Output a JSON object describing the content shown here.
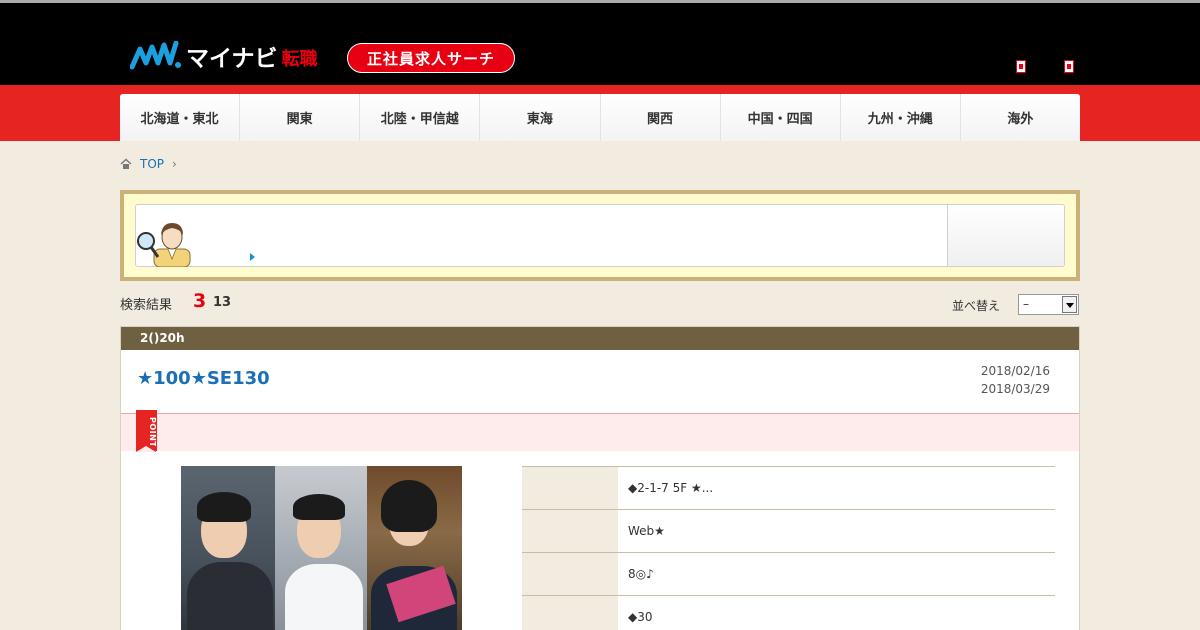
{
  "header": {
    "logo_text": "マイナビ",
    "logo_sub": "転職",
    "badge": "正社員求人サーチ"
  },
  "nav": {
    "items": [
      "北海道・東北",
      "関東",
      "北陸・甲信越",
      "東海",
      "関西",
      "中国・四国",
      "九州・沖縄",
      "海外"
    ]
  },
  "breadcrumb": {
    "home": "TOP"
  },
  "results": {
    "label": "検索結果",
    "count": "3",
    "total": "13"
  },
  "sort": {
    "label": "並べ替え",
    "selected": "–"
  },
  "job": {
    "header": "2()20h",
    "title": "★100★SE130",
    "date_posted": "2018/02/16",
    "date_end": "2018/03/29",
    "point_label": "POINT",
    "details": [
      "◆2-1-7 5F ★...",
      "Web★",
      "8◎♪",
      "◆30"
    ]
  },
  "colors": {
    "header_bg": "#000000",
    "brand_red": "#e62523",
    "page_bg": "#f1ebe0",
    "job_header_bg": "#6e6040",
    "link_blue": "#1a6fb5"
  },
  "icons": [
    "home-icon",
    "logo-mark-icon",
    "chevron-right-icon",
    "dropdown-arrow-icon"
  ]
}
